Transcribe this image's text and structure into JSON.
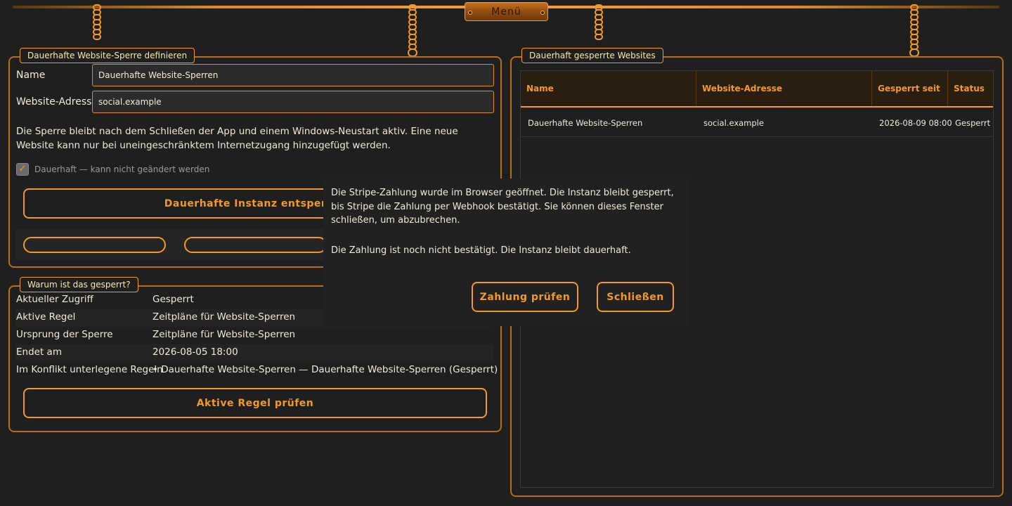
{
  "top_bar": {
    "menu_label": "Menü"
  },
  "define_panel": {
    "title": "Dauerhafte Website-Sperre definieren",
    "name_label": "Name",
    "name_value": "Dauerhafte Website-Sperren",
    "address_label": "Website-Adresse",
    "address_value": "social.example",
    "info_text": "Die Sperre bleibt nach dem Schließen der App und einem Windows-Neustart aktiv. Eine neue Website kann nur bei uneingeschränktem Internetzugang hinzugefügt werden.",
    "permanent_checkbox_label": "Dauerhaft — kann nicht geändert werden",
    "permanent_checked": true,
    "unlock_button_label": "Dauerhafte Instanz entsperren"
  },
  "why_panel": {
    "title": "Warum ist das gesperrt?",
    "rows": [
      {
        "key": "Aktueller Zugriff",
        "value": "Gesperrt"
      },
      {
        "key": "Aktive Regel",
        "value": "Zeitpläne für Website-Sperren"
      },
      {
        "key": "Ursprung der Sperre",
        "value": "Zeitpläne für Website-Sperren"
      },
      {
        "key": "Endet am",
        "value": "2026-08-05 18:00"
      },
      {
        "key": "Im Konflikt unterlegene Regeln",
        "value": "• Dauerhafte Website-Sperren — Dauerhafte Website-Sperren (Gesperrt)"
      }
    ],
    "check_button_label": "Aktive Regel prüfen"
  },
  "blocked_panel": {
    "title": "Dauerhaft gesperrte Websites",
    "columns": [
      "Name",
      "Website-Adresse",
      "Gesperrt seit",
      "Status"
    ],
    "rows": [
      [
        "Dauerhafte Website-Sperren",
        "social.example",
        "2026-08-09 08:00",
        "Gesperrt"
      ]
    ]
  },
  "dialog": {
    "message": "Die Stripe-Zahlung wurde im Browser geöffnet. Die Instanz bleibt gesperrt, bis Stripe die Zahlung per Webhook bestätigt. Sie können dieses Fenster schließen, um abzubrechen.",
    "status": "Die Zahlung ist noch nicht bestätigt. Die Instanz bleibt dauerhaft.",
    "check_payment_label": "Zahlung prüfen",
    "close_label": "Schließen"
  },
  "colors": {
    "accent": "#f39a26",
    "background": "#1f1f1f",
    "border": "#b76d18",
    "text": "#f2e8d6"
  }
}
